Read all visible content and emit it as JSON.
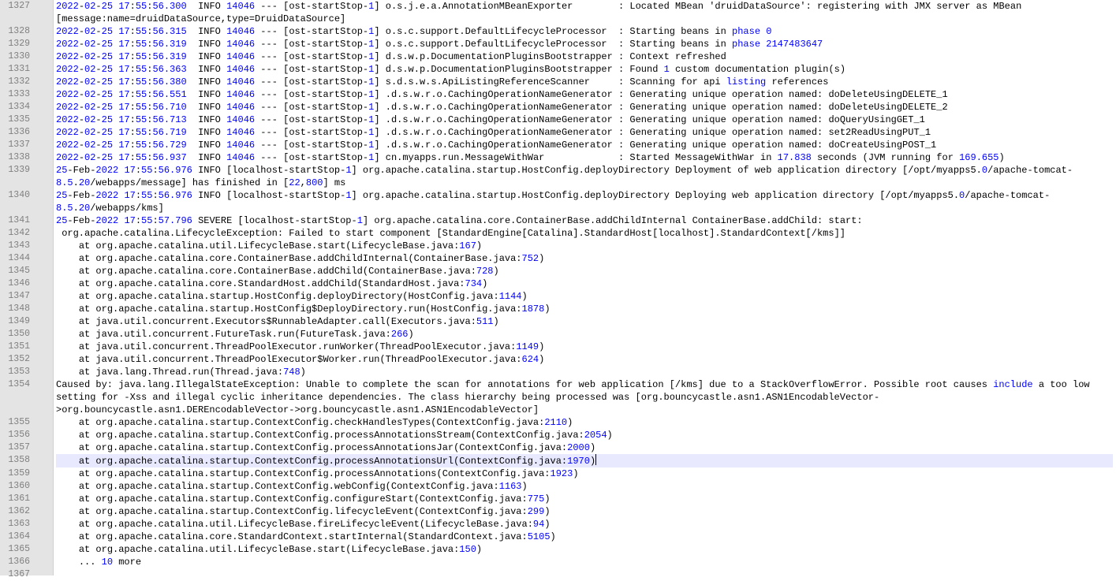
{
  "editor": {
    "lines": [
      {
        "num": "1327",
        "text": "2022-02-25 17:55:56.300  INFO 14046 --- [ost-startStop-1] o.s.j.e.a.AnnotationMBeanExporter        : Located MBean 'druidDataSource': registering with JMX server as MBean [message:name=druidDataSource,type=DruidDataSource]"
      },
      {
        "num": "1328",
        "text": "2022-02-25 17:55:56.315  INFO 14046 --- [ost-startStop-1] o.s.c.support.DefaultLifecycleProcessor  : Starting beans in phase 0"
      },
      {
        "num": "1329",
        "text": "2022-02-25 17:55:56.319  INFO 14046 --- [ost-startStop-1] o.s.c.support.DefaultLifecycleProcessor  : Starting beans in phase 2147483647"
      },
      {
        "num": "1330",
        "text": "2022-02-25 17:55:56.319  INFO 14046 --- [ost-startStop-1] d.s.w.p.DocumentationPluginsBootstrapper : Context refreshed"
      },
      {
        "num": "1331",
        "text": "2022-02-25 17:55:56.363  INFO 14046 --- [ost-startStop-1] d.s.w.p.DocumentationPluginsBootstrapper : Found 1 custom documentation plugin(s)"
      },
      {
        "num": "1332",
        "text": "2022-02-25 17:55:56.380  INFO 14046 --- [ost-startStop-1] s.d.s.w.s.ApiListingReferenceScanner     : Scanning for api listing references"
      },
      {
        "num": "1333",
        "text": "2022-02-25 17:55:56.551  INFO 14046 --- [ost-startStop-1] .d.s.w.r.o.CachingOperationNameGenerator : Generating unique operation named: doDeleteUsingDELETE_1"
      },
      {
        "num": "1334",
        "text": "2022-02-25 17:55:56.710  INFO 14046 --- [ost-startStop-1] .d.s.w.r.o.CachingOperationNameGenerator : Generating unique operation named: doDeleteUsingDELETE_2"
      },
      {
        "num": "1335",
        "text": "2022-02-25 17:55:56.713  INFO 14046 --- [ost-startStop-1] .d.s.w.r.o.CachingOperationNameGenerator : Generating unique operation named: doQueryUsingGET_1"
      },
      {
        "num": "1336",
        "text": "2022-02-25 17:55:56.719  INFO 14046 --- [ost-startStop-1] .d.s.w.r.o.CachingOperationNameGenerator : Generating unique operation named: set2ReadUsingPUT_1"
      },
      {
        "num": "1337",
        "text": "2022-02-25 17:55:56.729  INFO 14046 --- [ost-startStop-1] .d.s.w.r.o.CachingOperationNameGenerator : Generating unique operation named: doCreateUsingPOST_1"
      },
      {
        "num": "1338",
        "text": "2022-02-25 17:55:56.937  INFO 14046 --- [ost-startStop-1] cn.myapps.run.MessageWithWar             : Started MessageWithWar in 17.838 seconds (JVM running for 169.655)"
      },
      {
        "num": "1339",
        "text": "25-Feb-2022 17:55:56.976 INFO [localhost-startStop-1] org.apache.catalina.startup.HostConfig.deployDirectory Deployment of web application directory [/opt/myapps5.0/apache-tomcat-8.5.20/webapps/message] has finished in [22,800] ms"
      },
      {
        "num": "1340",
        "text": "25-Feb-2022 17:55:56.976 INFO [localhost-startStop-1] org.apache.catalina.startup.HostConfig.deployDirectory Deploying web application directory [/opt/myapps5.0/apache-tomcat-8.5.20/webapps/kms]"
      },
      {
        "num": "1341",
        "text": "25-Feb-2022 17:55:57.796 SEVERE [localhost-startStop-1] org.apache.catalina.core.ContainerBase.addChildInternal ContainerBase.addChild: start:"
      },
      {
        "num": "1342",
        "text": " org.apache.catalina.LifecycleException: Failed to start component [StandardEngine[Catalina].StandardHost[localhost].StandardContext[/kms]]"
      },
      {
        "num": "1343",
        "text": "    at org.apache.catalina.util.LifecycleBase.start(LifecycleBase.java:167)"
      },
      {
        "num": "1344",
        "text": "    at org.apache.catalina.core.ContainerBase.addChildInternal(ContainerBase.java:752)"
      },
      {
        "num": "1345",
        "text": "    at org.apache.catalina.core.ContainerBase.addChild(ContainerBase.java:728)"
      },
      {
        "num": "1346",
        "text": "    at org.apache.catalina.core.StandardHost.addChild(StandardHost.java:734)"
      },
      {
        "num": "1347",
        "text": "    at org.apache.catalina.startup.HostConfig.deployDirectory(HostConfig.java:1144)"
      },
      {
        "num": "1348",
        "text": "    at org.apache.catalina.startup.HostConfig$DeployDirectory.run(HostConfig.java:1878)"
      },
      {
        "num": "1349",
        "text": "    at java.util.concurrent.Executors$RunnableAdapter.call(Executors.java:511)"
      },
      {
        "num": "1350",
        "text": "    at java.util.concurrent.FutureTask.run(FutureTask.java:266)"
      },
      {
        "num": "1351",
        "text": "    at java.util.concurrent.ThreadPoolExecutor.runWorker(ThreadPoolExecutor.java:1149)"
      },
      {
        "num": "1352",
        "text": "    at java.util.concurrent.ThreadPoolExecutor$Worker.run(ThreadPoolExecutor.java:624)"
      },
      {
        "num": "1353",
        "text": "    at java.lang.Thread.run(Thread.java:748)"
      },
      {
        "num": "1354",
        "text": "Caused by: java.lang.IllegalStateException: Unable to complete the scan for annotations for web application [/kms] due to a StackOverflowError. Possible root causes include a too low setting for -Xss and illegal cyclic inheritance dependencies. The class hierarchy being processed was [org.bouncycastle.asn1.ASN1EncodableVector->org.bouncycastle.asn1.DEREncodableVector->org.bouncycastle.asn1.ASN1EncodableVector]"
      },
      {
        "num": "1355",
        "text": "    at org.apache.catalina.startup.ContextConfig.checkHandlesTypes(ContextConfig.java:2110)"
      },
      {
        "num": "1356",
        "text": "    at org.apache.catalina.startup.ContextConfig.processAnnotationsStream(ContextConfig.java:2054)"
      },
      {
        "num": "1357",
        "text": "    at org.apache.catalina.startup.ContextConfig.processAnnotationsJar(ContextConfig.java:2000)"
      },
      {
        "num": "1358",
        "text": "    at org.apache.catalina.startup.ContextConfig.processAnnotationsUrl(ContextConfig.java:1970)",
        "current": true
      },
      {
        "num": "1359",
        "text": "    at org.apache.catalina.startup.ContextConfig.processAnnotations(ContextConfig.java:1923)"
      },
      {
        "num": "1360",
        "text": "    at org.apache.catalina.startup.ContextConfig.webConfig(ContextConfig.java:1163)"
      },
      {
        "num": "1361",
        "text": "    at org.apache.catalina.startup.ContextConfig.configureStart(ContextConfig.java:775)"
      },
      {
        "num": "1362",
        "text": "    at org.apache.catalina.startup.ContextConfig.lifecycleEvent(ContextConfig.java:299)"
      },
      {
        "num": "1363",
        "text": "    at org.apache.catalina.util.LifecycleBase.fireLifecycleEvent(LifecycleBase.java:94)"
      },
      {
        "num": "1364",
        "text": "    at org.apache.catalina.core.StandardContext.startInternal(StandardContext.java:5105)"
      },
      {
        "num": "1365",
        "text": "    at org.apache.catalina.util.LifecycleBase.start(LifecycleBase.java:150)"
      },
      {
        "num": "1366",
        "text": "    ... 10 more"
      },
      {
        "num": "1367",
        "text": ""
      }
    ]
  },
  "colors": {
    "number": "#0000ff",
    "gutter_bg": "#e4e4e4",
    "current_line_bg": "#e8e8ff"
  }
}
